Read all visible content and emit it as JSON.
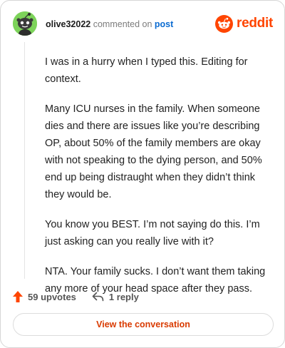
{
  "comment": {
    "username": "olive32022",
    "action_text": "commented on",
    "target_link": "post",
    "paragraphs": [
      "I was in a hurry when I typed this. Editing for context.",
      "Many ICU nurses in the family. When someone dies and there are issues like you’re describing OP, about 50% of the family members are okay with not speaking to the dying person, and 50% end up being distraught when they didn’t think they would be.",
      "You know you BEST. I’m not saying do this. I’m just asking can you really live with it?",
      "NTA. Your family sucks. I don’t want them taking any more of your head space after they pass."
    ]
  },
  "brand": {
    "name": "reddit",
    "color": "#ff4500",
    "icon": "reddit-logo-icon"
  },
  "actions": {
    "upvotes_label": "59 upvotes",
    "replies_label": "1 reply",
    "upvote_icon": "upvote-arrow-icon",
    "reply_icon": "reply-arrow-icon"
  },
  "cta": {
    "label": "View the conversation"
  },
  "colors": {
    "accent": "#d93a00",
    "upvote": "#ff4500",
    "link": "#0a6bd1",
    "avatar_bg": "#7dd35a"
  }
}
